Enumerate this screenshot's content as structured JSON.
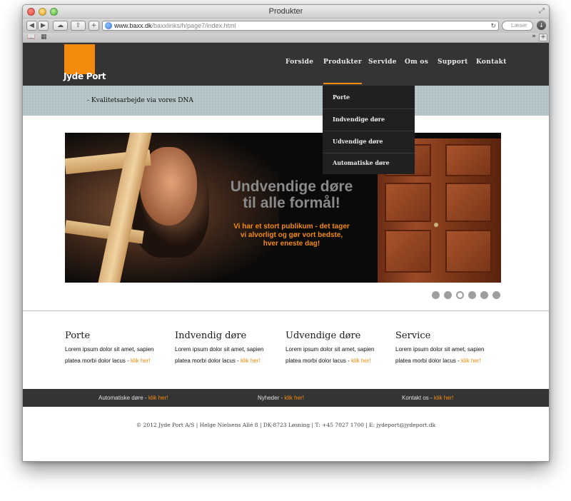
{
  "window": {
    "title": "Produkter"
  },
  "browser": {
    "url_host": "www.baxx.dk",
    "url_path": "/baxxlinks/h/page7/index.html",
    "search_placeholder": "Læser"
  },
  "site": {
    "logo_text": "Jyde Port",
    "nav": [
      "Forside",
      "Produkter",
      "Servide",
      "Om os",
      "Support",
      "Kontakt"
    ],
    "tagline": "- Kvalitetsarbejde via vores DNA",
    "dropdown": [
      "Porte",
      "Indvendige døre",
      "Udvendige døre",
      "Automatiske døre"
    ],
    "hero": {
      "headline_1": "Undvendige døre",
      "headline_2": "til alle formål!",
      "sub_1": "Vi har et stort publikum - det tager",
      "sub_2": "vi alvorligt og gør vort bedste,",
      "sub_3": "hver eneste dag!"
    },
    "columns": [
      {
        "title": "Porte",
        "line1": "Lorem ipsum dolor sit amet, sapien",
        "line2": "platea morbi dolor lacus - ",
        "link": "klik her!"
      },
      {
        "title": "Indvendig døre",
        "line1": "Lorem ipsum dolor sit amet, sapien",
        "line2": "platea morbi dolor lacus - ",
        "link": "klik her!"
      },
      {
        "title": "Udvendige døre",
        "line1": "Lorem ipsum dolor sit amet, sapien",
        "line2": "platea morbi dolor lacus - ",
        "link": "klik her!"
      },
      {
        "title": "Service",
        "line1": "Lorem ipsum dolor sit amet, sapien",
        "line2": "platea morbi dolor lacus - ",
        "link": "klik her!"
      }
    ],
    "footer_links": [
      {
        "label": "Automatiske døre - ",
        "link": "klik her!"
      },
      {
        "label": "Nyheder - ",
        "link": "klik her!"
      },
      {
        "label": "Kontakt os - ",
        "link": "klik her!"
      }
    ],
    "copyright": "© 2012 Jyde Port A/S | Helge Nielsens Allé 8 | DK-8723 Løsning | T: +45 7027 1700 | E: jydeport@jydeport.dk"
  },
  "colors": {
    "accent": "#f28b0d",
    "header_bg": "#343434",
    "dropdown_bg": "#202020"
  }
}
